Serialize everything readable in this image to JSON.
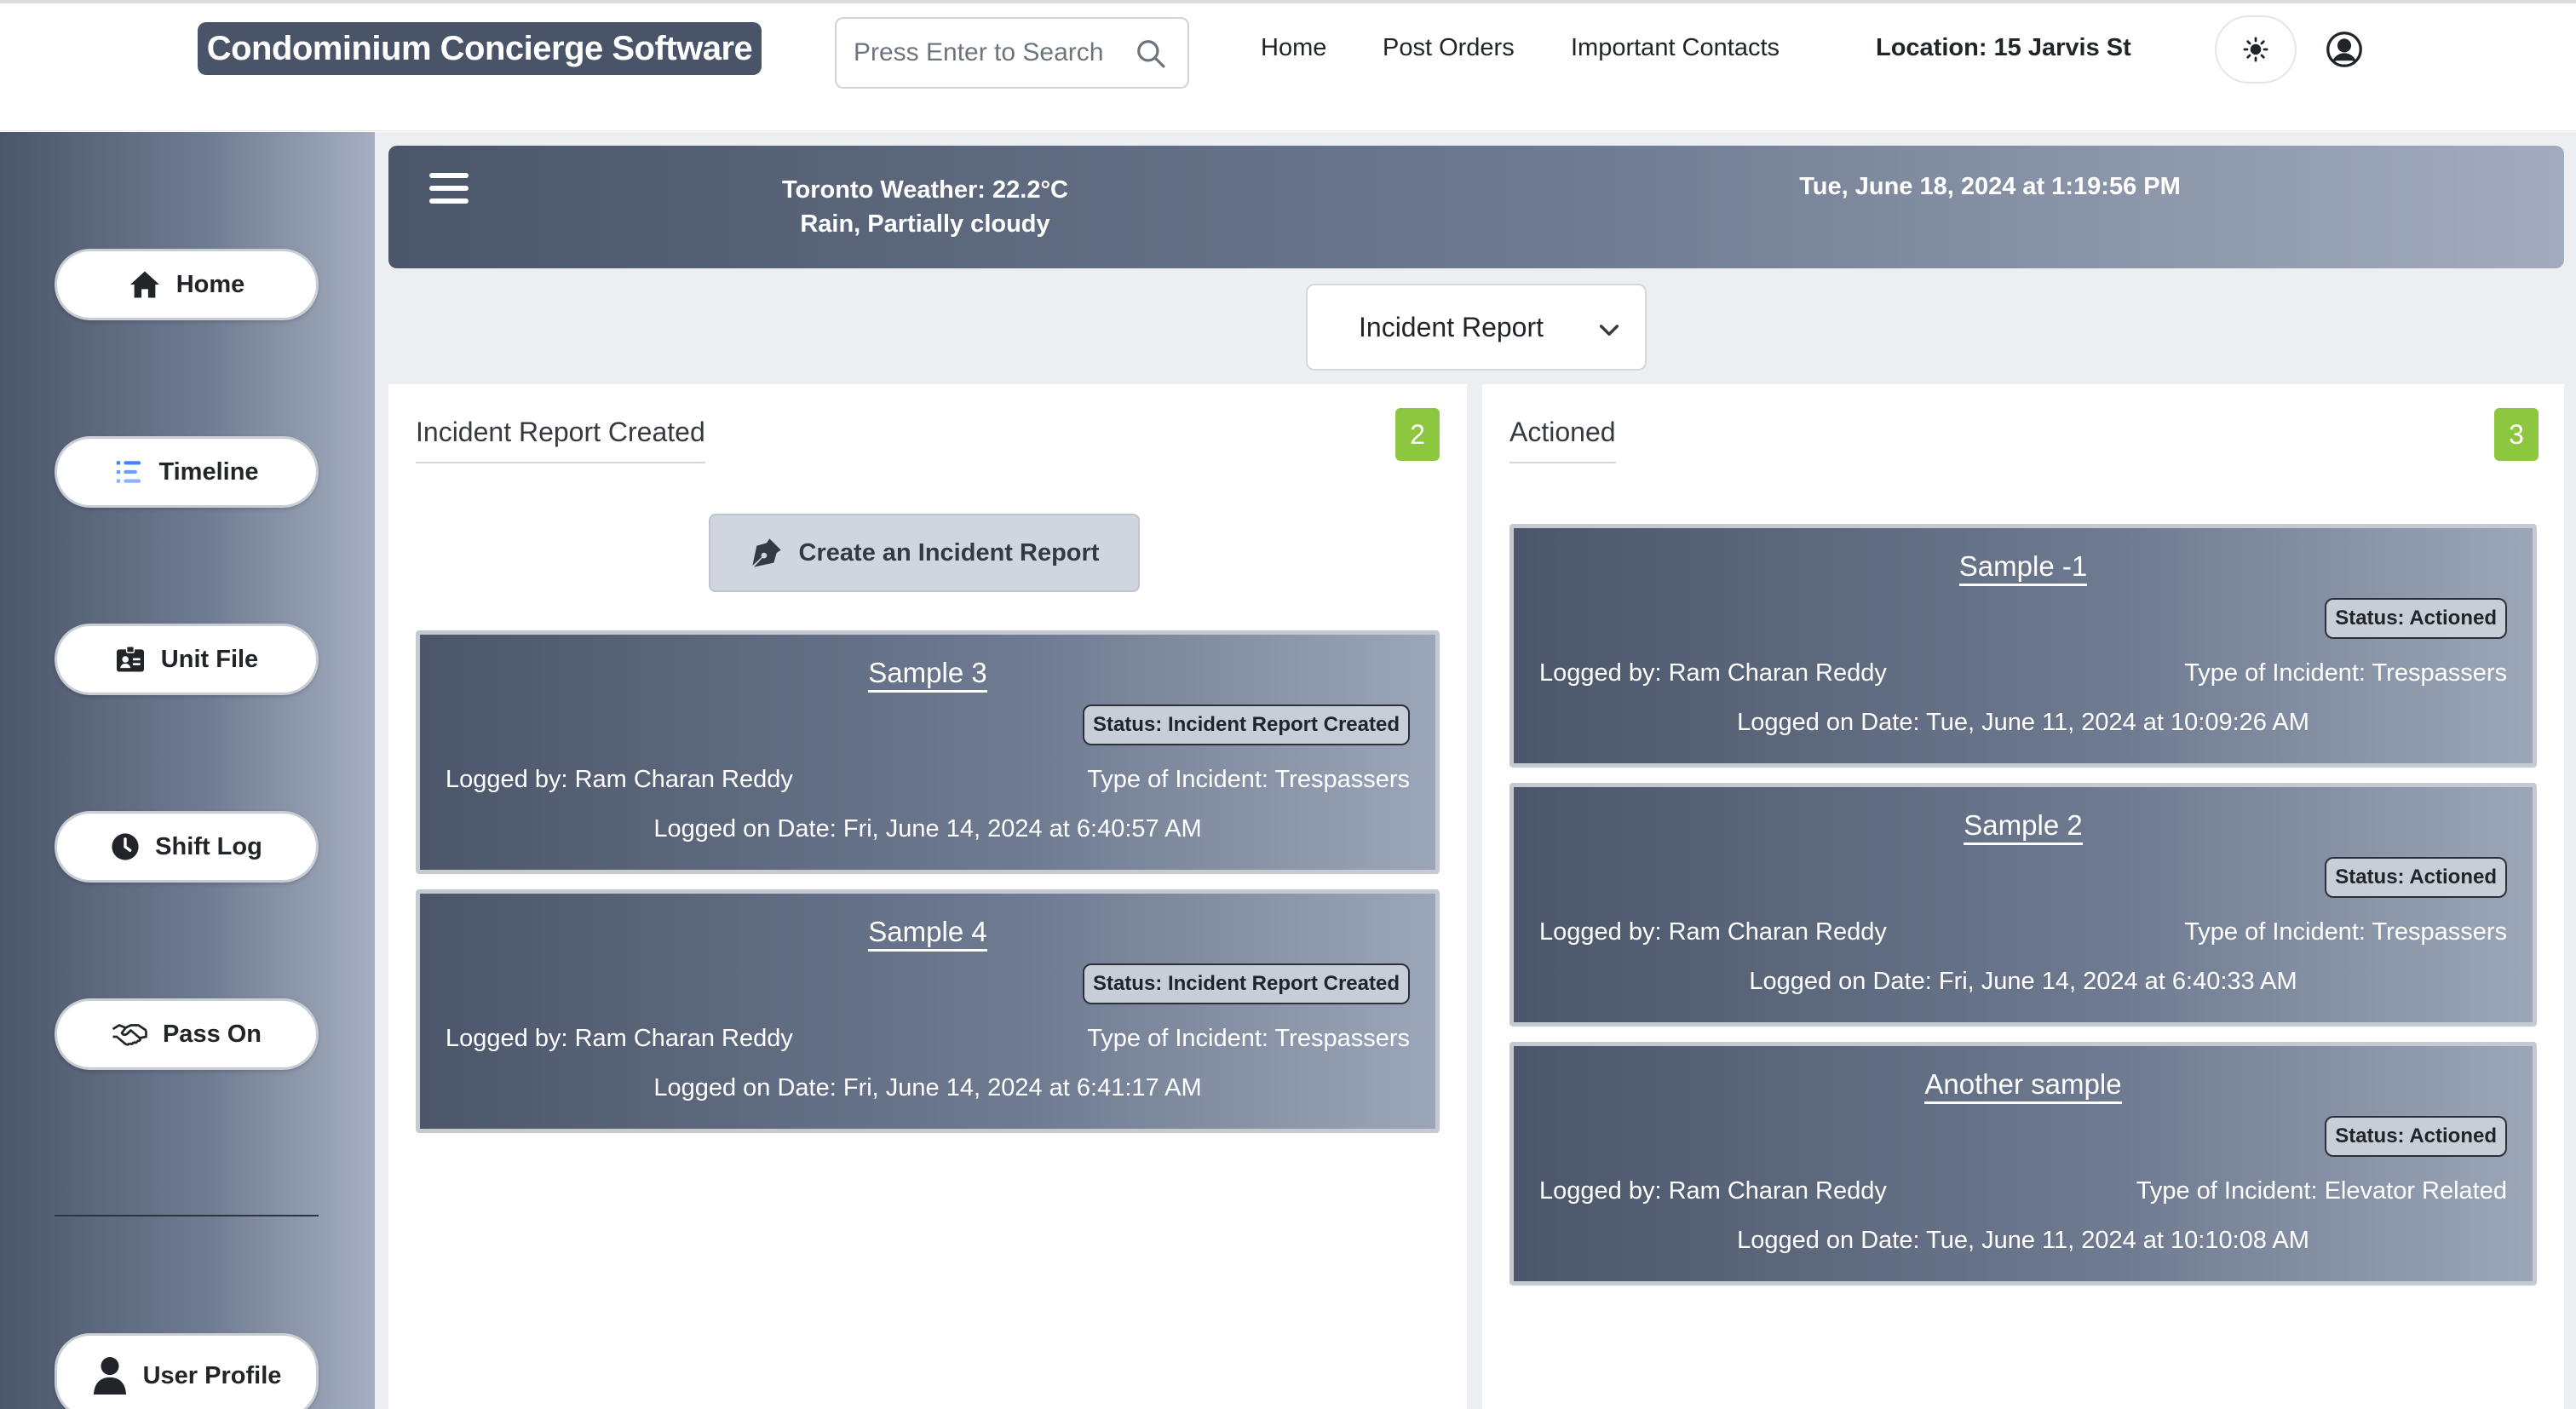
{
  "app": {
    "title": "Condominium Concierge Software"
  },
  "search": {
    "placeholder": "Press Enter to Search"
  },
  "topnav": {
    "home": "Home",
    "post_orders": "Post Orders",
    "contacts": "Important Contacts",
    "location": "Location: 15 Jarvis St"
  },
  "sidebar": {
    "items": [
      {
        "label": "Home",
        "icon": "house-icon"
      },
      {
        "label": "Timeline",
        "icon": "timeline-icon"
      },
      {
        "label": "Unit File",
        "icon": "id-card-icon"
      },
      {
        "label": "Shift Log",
        "icon": "clock-icon"
      },
      {
        "label": "Pass On",
        "icon": "handshake-icon"
      },
      {
        "label": "User Profile",
        "icon": "user-icon"
      }
    ]
  },
  "banner": {
    "weather_line1": "Toronto Weather: 22.2°C",
    "weather_line2": "Rain, Partially cloudy",
    "datetime": "Tue, June 18, 2024 at 1:19:56 PM"
  },
  "report_select": {
    "value": "Incident Report"
  },
  "columns": {
    "created": {
      "title": "Incident Report Created",
      "count": "2",
      "create_button": "Create an Incident Report",
      "cards": [
        {
          "title": "Sample 3",
          "status": "Status: Incident Report Created",
          "logged_by": "Logged by: Ram Charan Reddy",
          "type": "Type of Incident: Trespassers",
          "logged_on": "Logged on Date: Fri, June 14, 2024 at 6:40:57 AM"
        },
        {
          "title": "Sample 4",
          "status": "Status: Incident Report Created",
          "logged_by": "Logged by: Ram Charan Reddy",
          "type": "Type of Incident: Trespassers",
          "logged_on": "Logged on Date: Fri, June 14, 2024 at 6:41:17 AM"
        }
      ]
    },
    "actioned": {
      "title": "Actioned",
      "count": "3",
      "cards": [
        {
          "title": "Sample -1",
          "status": "Status: Actioned",
          "logged_by": "Logged by: Ram Charan Reddy",
          "type": "Type of Incident: Trespassers",
          "logged_on": "Logged on Date: Tue, June 11, 2024 at 10:09:26 AM"
        },
        {
          "title": "Sample 2",
          "status": "Status: Actioned",
          "logged_by": "Logged by: Ram Charan Reddy",
          "type": "Type of Incident: Trespassers",
          "logged_on": "Logged on Date: Fri, June 14, 2024 at 6:40:33 AM"
        },
        {
          "title": "Another sample",
          "status": "Status: Actioned",
          "logged_by": "Logged by: Ram Charan Reddy",
          "type": "Type of Incident: Elevator Related",
          "logged_on": "Logged on Date: Tue, June 11, 2024 at 10:10:08 AM"
        }
      ]
    }
  },
  "colors": {
    "brand": "#495468",
    "badge": "#8dc63f",
    "sidebar_dark": "#4b566a"
  }
}
